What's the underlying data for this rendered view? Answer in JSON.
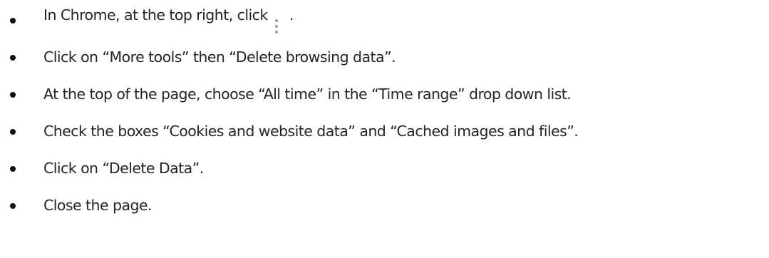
{
  "steps": [
    {
      "text": "In Chrome, at the top right, click",
      "suffix": ".",
      "icon": "kebab-menu-icon"
    },
    {
      "text": "Click on “More tools” then “Delete browsing data”."
    },
    {
      "text": "At the top of the page, choose “All time” in the “Time range” drop down list."
    },
    {
      "text": "Check the boxes “Cookies and website data” and “Cached images and files”."
    },
    {
      "text": "Click on “Delete Data”."
    },
    {
      "text": "Close the page."
    }
  ]
}
